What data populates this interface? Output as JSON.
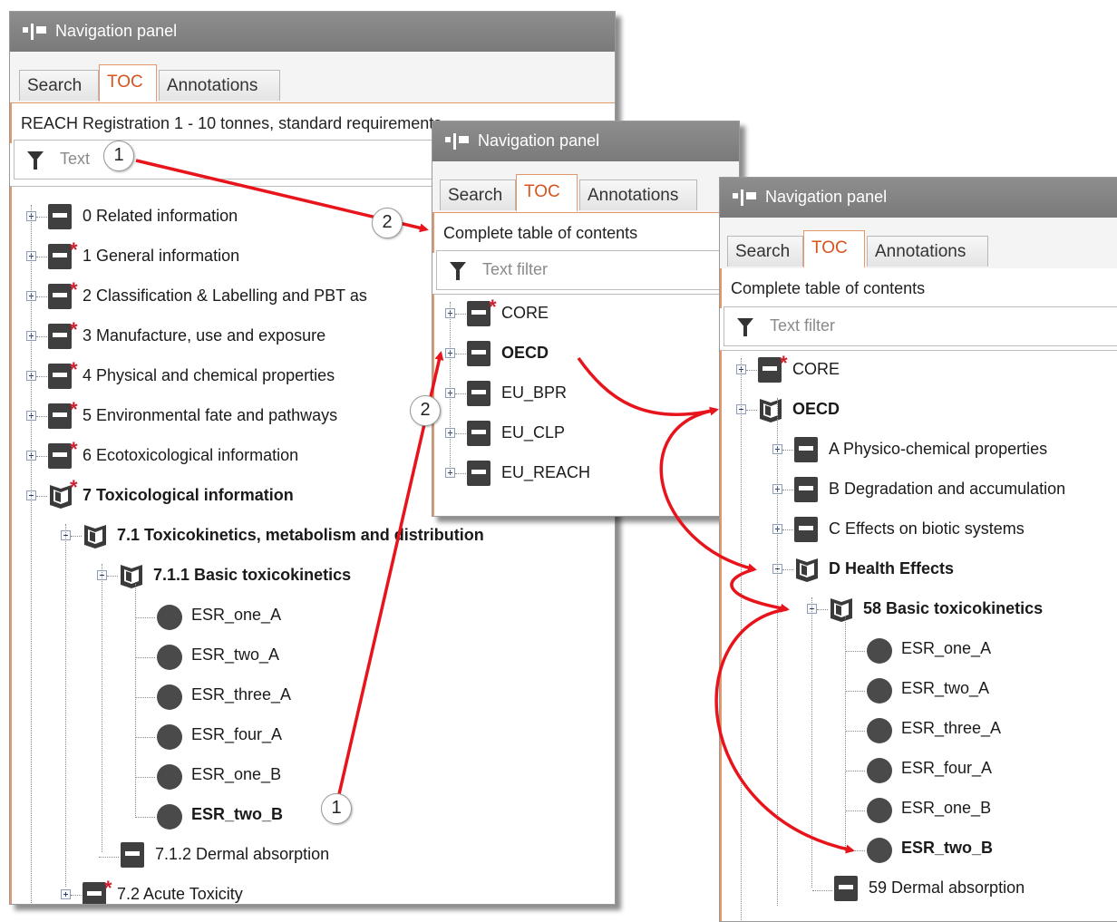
{
  "panel_title": "Navigation panel",
  "tabs": [
    "Search",
    "TOC",
    "Annotations"
  ],
  "panel1": {
    "toc_header": "REACH Registration 1 - 10 tonnes, standard requirements",
    "filter_placeholder": "Text",
    "items": [
      "0 Related information",
      "1 General information",
      "2 Classification & Labelling and PBT as",
      "3 Manufacture, use and exposure",
      "4 Physical and chemical properties",
      "5 Environmental fate and pathways",
      "6 Ecotoxicological information",
      "7 Toxicological information",
      "7.1 Toxicokinetics, metabolism and distribution",
      "7.1.1 Basic toxicokinetics",
      "ESR_one_A",
      "ESR_two_A",
      "ESR_three_A",
      "ESR_four_A",
      "ESR_one_B",
      "ESR_two_B",
      "7.1.2 Dermal absorption",
      "7.2 Acute Toxicity"
    ]
  },
  "panel2": {
    "toc_header": "Complete table of contents",
    "filter_placeholder": "Text filter",
    "items": [
      "CORE",
      "OECD",
      "EU_BPR",
      "EU_CLP",
      "EU_REACH"
    ]
  },
  "panel3": {
    "toc_header": "Complete table of contents",
    "filter_placeholder": "Text filter",
    "items": [
      "CORE",
      "OECD",
      "A Physico-chemical properties",
      "B Degradation and accumulation",
      "C Effects on biotic systems",
      "D Health Effects",
      "58 Basic toxicokinetics",
      "ESR_one_A",
      "ESR_two_A",
      "ESR_three_A",
      "ESR_four_A",
      "ESR_one_B",
      "ESR_two_B",
      "59 Dermal absorption"
    ]
  },
  "callouts": {
    "c1a": "1",
    "c2a": "2",
    "c2b": "2",
    "c1b": "1"
  },
  "colors": {
    "accent_tab": "#d9531e",
    "tab_border": "#e4976b",
    "arrow": "#e8141c",
    "required_star": "#cc2030"
  }
}
